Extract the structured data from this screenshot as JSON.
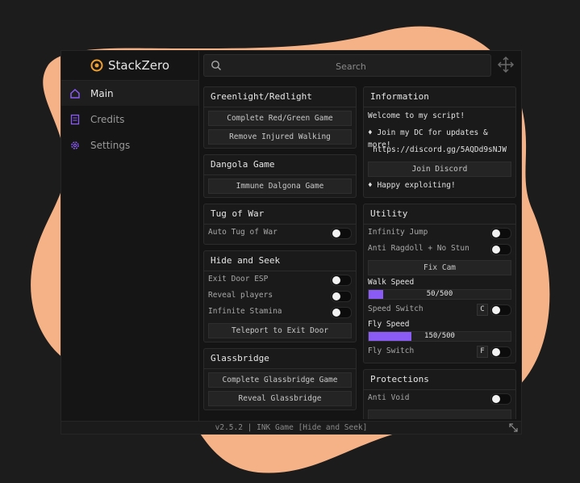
{
  "app": {
    "title": "StackZero"
  },
  "colors": {
    "accent": "#8a5cf5",
    "blob": "#f5b287",
    "background": "#1c1c1c"
  },
  "sidebar": {
    "items": [
      {
        "label": "Main",
        "icon": "home-icon",
        "active": true
      },
      {
        "label": "Credits",
        "icon": "document-icon",
        "active": false
      },
      {
        "label": "Settings",
        "icon": "gear-icon",
        "active": false
      }
    ]
  },
  "search": {
    "placeholder": "Search"
  },
  "sections": {
    "greenlight": {
      "title": "Greenlight/Redlight",
      "buttons": [
        "Complete Red/Green Game",
        "Remove Injured Walking"
      ]
    },
    "dangola": {
      "title": "Dangola Game",
      "buttons": [
        "Immune Dalgona Game"
      ]
    },
    "tugofwar": {
      "title": "Tug of War",
      "toggles": [
        {
          "label": "Auto Tug of War",
          "on": false
        }
      ]
    },
    "hideseek": {
      "title": "Hide and Seek",
      "toggles": [
        {
          "label": "Exit Door ESP",
          "on": false
        },
        {
          "label": "Reveal players",
          "on": false
        },
        {
          "label": "Infinite Stamina",
          "on": false
        }
      ],
      "buttons": [
        "Teleport to Exit Door"
      ]
    },
    "glassbridge": {
      "title": "Glassbridge",
      "buttons": [
        "Complete Glassbridge Game",
        "Reveal Glassbridge"
      ]
    },
    "information": {
      "title": "Information",
      "lines": [
        "Welcome to my script!",
        "♦ Join my DC for updates & more!",
        "https://discord.gg/5AQDd9sNJW"
      ],
      "button": "Join Discord",
      "footer_line": "♦ Happy exploiting!"
    },
    "utility": {
      "title": "Utility",
      "toggles": [
        {
          "label": "Infinity Jump",
          "on": false
        },
        {
          "label": "Anti Ragdoll + No Stun",
          "on": false
        }
      ],
      "button": "Fix Cam",
      "walk_speed": {
        "label": "Walk Speed",
        "value": 50,
        "max": 500,
        "text": "50/500"
      },
      "speed_switch": {
        "label": "Speed Switch",
        "key": "C",
        "on": false
      },
      "fly_speed": {
        "label": "Fly Speed",
        "value": 150,
        "max": 500,
        "text": "150/500"
      },
      "fly_switch": {
        "label": "Fly Switch",
        "key": "F",
        "on": false
      }
    },
    "protections": {
      "title": "Protections",
      "toggles": [
        {
          "label": "Anti Void",
          "on": false
        }
      ]
    }
  },
  "footer": {
    "text": "v2.5.2 | INK Game [Hide and Seek]"
  }
}
